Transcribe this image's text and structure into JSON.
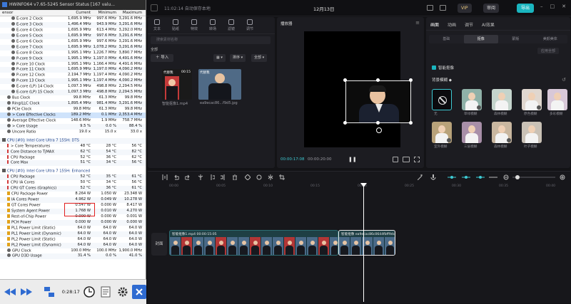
{
  "hwinfo": {
    "title": "HWiNFO64 v7.65-5245 Sensor Status [167 valu...",
    "columns": [
      "ensor",
      "Current",
      "Minimum",
      "Maximum"
    ],
    "rows": [
      {
        "label": "E-core 2 Clock",
        "cur": "1,695.9 MHz",
        "min": "997.6 MHz",
        "max": "3,291.6 MHz",
        "icon": "dot",
        "ind": 1
      },
      {
        "label": "E-core 3 Clock",
        "cur": "1,496.4 MHz",
        "min": "943.9 MHz",
        "max": "3,291.6 MHz",
        "icon": "dot",
        "ind": 1
      },
      {
        "label": "E-core 4 Clock",
        "cur": "1,695.9 MHz",
        "min": "613.4 MHz",
        "max": "3,292.0 MHz",
        "icon": "dot",
        "ind": 1
      },
      {
        "label": "E-core 5 Clock",
        "cur": "1,695.9 MHz",
        "min": "997.6 MHz",
        "max": "3,291.6 MHz",
        "icon": "dot",
        "ind": 1
      },
      {
        "label": "E-core 6 Clock",
        "cur": "1,695.9 MHz",
        "min": "997.6 MHz",
        "max": "3,291.6 MHz",
        "icon": "dot",
        "ind": 1
      },
      {
        "label": "E-core 7 Clock",
        "cur": "1,695.9 MHz",
        "min": "1,078.2 MHz",
        "max": "3,291.6 MHz",
        "icon": "dot",
        "ind": 1
      },
      {
        "label": "E-core 8 Clock",
        "cur": "1,995.1 MHz",
        "min": "1,226.7 MHz",
        "max": "3,890.7 MHz",
        "icon": "dot",
        "ind": 1
      },
      {
        "label": "P-core 9 Clock",
        "cur": "1,995.1 MHz",
        "min": "1,197.0 MHz",
        "max": "4,491.6 MHz",
        "icon": "dot",
        "ind": 1
      },
      {
        "label": "P-core 10 Clock",
        "cur": "1,995.1 MHz",
        "min": "1,166.4 MHz",
        "max": "4,491.6 MHz",
        "icon": "dot",
        "ind": 1
      },
      {
        "label": "P-core 11 Clock",
        "cur": "1,695.9 MHz",
        "min": "1,197.0 MHz",
        "max": "4,090.2 MHz",
        "icon": "dot",
        "ind": 1
      },
      {
        "label": "P-core 12 Clock",
        "cur": "2,194.7 MHz",
        "min": "1,197.4 MHz",
        "max": "4,090.2 MHz",
        "icon": "dot",
        "ind": 1
      },
      {
        "label": "P-core 13 Clock",
        "cur": "1,995.1 MHz",
        "min": "1,197.4 MHz",
        "max": "4,090.2 MHz",
        "icon": "dot",
        "ind": 1
      },
      {
        "label": "E-core (LP) 14 Clock",
        "cur": "1,097.3 MHz",
        "min": "498.8 MHz",
        "max": "2,294.5 MHz",
        "icon": "dot",
        "ind": 1
      },
      {
        "label": "E-core (LP) 15 Clock",
        "cur": "1,097.3 MHz",
        "min": "498.8 MHz",
        "max": "2,294.5 MHz",
        "icon": "dot",
        "ind": 1
      },
      {
        "label": "Bus Clock",
        "cur": "99.8 MHz",
        "min": "61.3 MHz",
        "max": "99.8 MHz",
        "icon": "dot",
        "ind": 0
      },
      {
        "label": "Ring/LLC Clock",
        "cur": "1,895.4 MHz",
        "min": "981.4 MHz",
        "max": "3,291.6 MHz",
        "icon": "dot",
        "ind": 0
      },
      {
        "label": "PCIe Clock",
        "cur": "99.8 MHz",
        "min": "61.3 MHz",
        "max": "99.8 MHz",
        "icon": "dot",
        "ind": 0
      },
      {
        "label": "> Core Effective Clocks",
        "cur": "189.2 MHz",
        "min": "0.1 MHz",
        "max": "2,353.4 MHz",
        "icon": "dot",
        "ind": 0,
        "hl": true
      },
      {
        "label": "Average Effective Clock",
        "cur": "148.6 MHz",
        "min": "1.9 MHz",
        "max": "758.7 MHz",
        "icon": "dot",
        "ind": 0
      },
      {
        "label": "> Core Usage",
        "cur": "9.5 %",
        "min": "0.0 %",
        "max": "88.4 %",
        "icon": "dot",
        "ind": 0
      },
      {
        "label": "Uncore Ratio",
        "cur": "19.0 x",
        "min": "15.0 x",
        "max": "33.0 x",
        "icon": "dot",
        "ind": 0
      },
      {
        "gap": true
      },
      {
        "label": "CPU [#0]: Intel Core Ultra 7 155H: DTS",
        "section": true
      },
      {
        "label": "> Core Temperatures",
        "cur": "48 °C",
        "min": "28 °C",
        "max": "56 °C",
        "icon": "therm",
        "ind": 0
      },
      {
        "label": "Core Distance to TjMAX",
        "cur": "62 °C",
        "min": "54 °C",
        "max": "82 °C",
        "icon": "therm",
        "ind": 0
      },
      {
        "label": "CPU Package",
        "cur": "52 °C",
        "min": "36 °C",
        "max": "62 °C",
        "icon": "therm",
        "ind": 0
      },
      {
        "label": "Core Max",
        "cur": "51 °C",
        "min": "34 °C",
        "max": "56 °C",
        "icon": "therm",
        "ind": 0
      },
      {
        "gap": true
      },
      {
        "label": "CPU [#0]: Intel Core Ultra 7 155H: Enhanced",
        "section": true
      },
      {
        "label": "CPU Package",
        "cur": "52 °C",
        "min": "35 °C",
        "max": "61 °C",
        "icon": "therm",
        "ind": 0
      },
      {
        "label": "CPU IA Cores",
        "cur": "50 °C",
        "min": "34 °C",
        "max": "56 °C",
        "icon": "therm",
        "ind": 0
      },
      {
        "label": "CPU GT Cores (Graphics)",
        "cur": "52 °C",
        "min": "36 °C",
        "max": "61 °C",
        "icon": "therm",
        "ind": 0
      },
      {
        "label": "CPU Package Power",
        "cur": "8.264 W",
        "min": "1.050 W",
        "max": "23.348 W",
        "icon": "bolt",
        "ind": 0
      },
      {
        "label": "IA Cores Power",
        "cur": "4.962 W",
        "min": "0.049 W",
        "max": "10.278 W",
        "icon": "bolt",
        "ind": 0
      },
      {
        "label": "GT Cores Power",
        "cur": "0.547 W",
        "min": "0.000 W",
        "max": "8.417 W",
        "icon": "bolt",
        "ind": 0
      },
      {
        "label": "System Agent Power",
        "cur": "1.768 W",
        "min": "0.010 W",
        "max": "4.270 W",
        "icon": "bolt",
        "ind": 0
      },
      {
        "label": "Rest-of-Chip Power",
        "cur": "0.000 W",
        "min": "0.000 W",
        "max": "0.001 W",
        "icon": "bolt",
        "ind": 0
      },
      {
        "label": "PCH Power",
        "cur": "0.000 W",
        "min": "0.000 W",
        "max": "0.000 W",
        "icon": "bolt",
        "ind": 0
      },
      {
        "label": "PL1 Power Limit (Static)",
        "cur": "64.0 W",
        "min": "64.0 W",
        "max": "64.0 W",
        "icon": "bolt",
        "ind": 0
      },
      {
        "label": "PL1 Power Limit (Dynamic)",
        "cur": "64.0 W",
        "min": "64.0 W",
        "max": "64.0 W",
        "icon": "bolt",
        "ind": 0
      },
      {
        "label": "PL2 Power Limit (Static)",
        "cur": "64.0 W",
        "min": "64.0 W",
        "max": "64.0 W",
        "icon": "bolt",
        "ind": 0
      },
      {
        "label": "PL2 Power Limit (Dynamic)",
        "cur": "64.0 W",
        "min": "64.0 W",
        "max": "64.0 W",
        "icon": "bolt",
        "ind": 0
      },
      {
        "label": "GPU Clock",
        "cur": "100.0 MHz",
        "min": "100.0 MHz",
        "max": "1,900.0 MHz",
        "icon": "dot",
        "ind": 0
      },
      {
        "label": "GPU D3D Usage",
        "cur": "31.4 %",
        "min": "0.0 %",
        "max": "41.0 %",
        "icon": "dot",
        "ind": 0
      }
    ],
    "timer": "0:28:17"
  },
  "capcut": {
    "title": "11:02:14 自动保存本地",
    "date": "12月13日",
    "vip": "VIP",
    "share": "审阅",
    "export": "导出",
    "media_tabs": [
      "文本",
      "贴纸",
      "特效",
      "转场",
      "滤镜",
      "调节"
    ],
    "search_placeholder": "搜索素材名称",
    "all_label": "全部",
    "import_label": "导入",
    "sort_label": "排序",
    "filter_label": "全部",
    "media_items": [
      {
        "name": "智能抠像1.mp4",
        "badge": "代替我",
        "dur": "00:15"
      },
      {
        "name": "ea9ecac86...f9d5.jpg",
        "badge": "代替我",
        "dur": ""
      }
    ],
    "player_title": "播放器",
    "time_current": "00:00:17:08",
    "time_total": "00:00:20:00",
    "right_tabs": [
      "画面",
      "动画",
      "调节",
      "AI效果"
    ],
    "sub_tabs": [
      "基础",
      "抠像",
      "蒙版",
      "美颜美体"
    ],
    "apply_all": "应用全部",
    "smart_label": "智能抠像",
    "blur_label": "背景模糊",
    "blur_options": [
      "无",
      "草绿模糊",
      "森林模糊",
      "原色模糊",
      "多彩模糊",
      "室外模糊",
      "三层模糊",
      "森林模糊",
      "叶子模糊"
    ],
    "cover_label": "封面",
    "clip1_label": "智能抠像1.mp4  00:00:15:05",
    "clip2_label": "智能抠像  ea9ecac86c0644fbff9dc",
    "ruler": [
      "00:00",
      "00:05",
      "00:10",
      "00:15",
      "00:20",
      "00:25",
      "00:30",
      "00:35",
      "00:40"
    ]
  }
}
